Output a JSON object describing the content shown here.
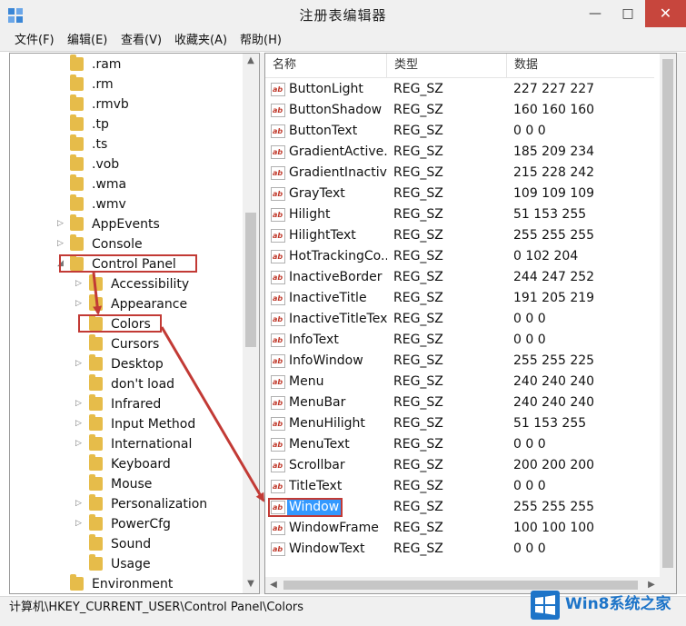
{
  "window": {
    "title": "注册表编辑器",
    "minimize_glyph": "—",
    "maximize_glyph": "□",
    "close_glyph": "✕"
  },
  "menu": [
    "文件(F)",
    "编辑(E)",
    "查看(V)",
    "收藏夹(A)",
    "帮助(H)"
  ],
  "tree": {
    "items": [
      {
        "label": ".ram",
        "indent": 0,
        "expander": ""
      },
      {
        "label": ".rm",
        "indent": 0,
        "expander": ""
      },
      {
        "label": ".rmvb",
        "indent": 0,
        "expander": ""
      },
      {
        "label": ".tp",
        "indent": 0,
        "expander": ""
      },
      {
        "label": ".ts",
        "indent": 0,
        "expander": ""
      },
      {
        "label": ".vob",
        "indent": 0,
        "expander": ""
      },
      {
        "label": ".wma",
        "indent": 0,
        "expander": ""
      },
      {
        "label": ".wmv",
        "indent": 0,
        "expander": ""
      },
      {
        "label": "AppEvents",
        "indent": 0,
        "expander": "▷"
      },
      {
        "label": "Console",
        "indent": 0,
        "expander": "▷"
      },
      {
        "label": "Control Panel",
        "indent": 0,
        "expander": "◢",
        "highlighted": true
      },
      {
        "label": "Accessibility",
        "indent": 1,
        "expander": "▷"
      },
      {
        "label": "Appearance",
        "indent": 1,
        "expander": "▷"
      },
      {
        "label": "Colors",
        "indent": 1,
        "expander": "",
        "highlighted": true
      },
      {
        "label": "Cursors",
        "indent": 1,
        "expander": ""
      },
      {
        "label": "Desktop",
        "indent": 1,
        "expander": "▷"
      },
      {
        "label": "don't load",
        "indent": 1,
        "expander": ""
      },
      {
        "label": "Infrared",
        "indent": 1,
        "expander": "▷"
      },
      {
        "label": "Input Method",
        "indent": 1,
        "expander": "▷"
      },
      {
        "label": "International",
        "indent": 1,
        "expander": "▷"
      },
      {
        "label": "Keyboard",
        "indent": 1,
        "expander": ""
      },
      {
        "label": "Mouse",
        "indent": 1,
        "expander": ""
      },
      {
        "label": "Personalization",
        "indent": 1,
        "expander": "▷"
      },
      {
        "label": "PowerCfg",
        "indent": 1,
        "expander": "▷"
      },
      {
        "label": "Sound",
        "indent": 1,
        "expander": ""
      },
      {
        "label": "Usage",
        "indent": 1,
        "expander": ""
      },
      {
        "label": "Environment",
        "indent": 0,
        "expander": ""
      }
    ],
    "scroll_up_glyph": "▲",
    "scroll_down_glyph": "▼"
  },
  "list": {
    "headers": {
      "name": "名称",
      "type": "类型",
      "data": "数据"
    },
    "value_icon": "ab",
    "rows": [
      {
        "name": "ButtonLight",
        "type": "REG_SZ",
        "data": "227 227 227"
      },
      {
        "name": "ButtonShadow",
        "type": "REG_SZ",
        "data": "160 160 160"
      },
      {
        "name": "ButtonText",
        "type": "REG_SZ",
        "data": "0 0 0"
      },
      {
        "name": "GradientActive...",
        "type": "REG_SZ",
        "data": "185 209 234"
      },
      {
        "name": "GradientInactiv...",
        "type": "REG_SZ",
        "data": "215 228 242"
      },
      {
        "name": "GrayText",
        "type": "REG_SZ",
        "data": "109 109 109"
      },
      {
        "name": "Hilight",
        "type": "REG_SZ",
        "data": "51 153 255"
      },
      {
        "name": "HilightText",
        "type": "REG_SZ",
        "data": "255 255 255"
      },
      {
        "name": "HotTrackingCo...",
        "type": "REG_SZ",
        "data": "0 102 204"
      },
      {
        "name": "InactiveBorder",
        "type": "REG_SZ",
        "data": "244 247 252"
      },
      {
        "name": "InactiveTitle",
        "type": "REG_SZ",
        "data": "191 205 219"
      },
      {
        "name": "InactiveTitleText",
        "type": "REG_SZ",
        "data": "0 0 0"
      },
      {
        "name": "InfoText",
        "type": "REG_SZ",
        "data": "0 0 0"
      },
      {
        "name": "InfoWindow",
        "type": "REG_SZ",
        "data": "255 255 225"
      },
      {
        "name": "Menu",
        "type": "REG_SZ",
        "data": "240 240 240"
      },
      {
        "name": "MenuBar",
        "type": "REG_SZ",
        "data": "240 240 240"
      },
      {
        "name": "MenuHilight",
        "type": "REG_SZ",
        "data": "51 153 255"
      },
      {
        "name": "MenuText",
        "type": "REG_SZ",
        "data": "0 0 0"
      },
      {
        "name": "Scrollbar",
        "type": "REG_SZ",
        "data": "200 200 200"
      },
      {
        "name": "TitleText",
        "type": "REG_SZ",
        "data": "0 0 0"
      },
      {
        "name": "Window",
        "type": "REG_SZ",
        "data": "255 255 255",
        "selected": true
      },
      {
        "name": "WindowFrame",
        "type": "REG_SZ",
        "data": "100 100 100"
      },
      {
        "name": "WindowText",
        "type": "REG_SZ",
        "data": "0 0 0"
      }
    ],
    "scroll_left_glyph": "◀",
    "scroll_right_glyph": "▶"
  },
  "status": {
    "path": "计算机\\HKEY_CURRENT_USER\\Control Panel\\Colors"
  },
  "watermark": {
    "text": "Win8系统之家"
  },
  "colors": {
    "selection": "#3399ff",
    "annotation": "#c23a35",
    "close_button": "#c7463d",
    "folder": "#e6bc4a"
  }
}
